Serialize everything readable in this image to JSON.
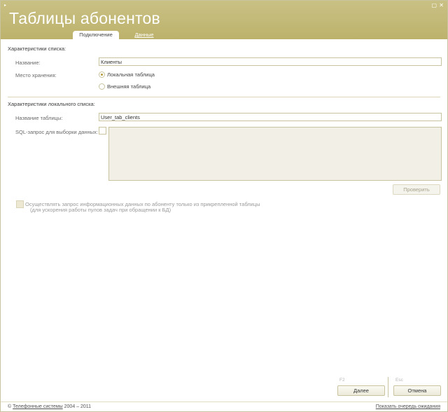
{
  "window": {
    "title": "Таблицы абонентов",
    "menu_glyph": "▸",
    "max_glyph": "▢",
    "close_glyph": "✕"
  },
  "tabs": [
    {
      "label": "Подключение",
      "active": true
    },
    {
      "label": "Данные",
      "active": false
    }
  ],
  "list_section": {
    "title": "Характеристики списка:",
    "name_label": "Название:",
    "name_value": "Клиенты",
    "storage_label": "Место хранения:",
    "storage_options": [
      {
        "label": "Локальная таблица",
        "selected": true
      },
      {
        "label": "Внешняя таблица",
        "selected": false
      }
    ]
  },
  "local_section": {
    "title": "Характеристики локального списка:",
    "table_label": "Название таблицы:",
    "table_value": "User_tab_clients",
    "sql_label": "SQL-запрос для выборки данных:",
    "sql_value": "",
    "check_button": "Проверить"
  },
  "option": {
    "line1": "Осуществлять запрос информационных данных по абоненту только из прикрепленной таблицы",
    "line2": "(для ускорения работы пулов задач при обращении к БД)",
    "checked": false
  },
  "actions": {
    "next_key": "F2",
    "next_label": "Далее",
    "cancel_key": "Esc",
    "cancel_label": "Отмена"
  },
  "footer": {
    "copyright_symbol": "©",
    "company": "Телефонные системы",
    "years": "2004 – 2011",
    "queue_link": "Показать очередь ожидания"
  },
  "colors": {
    "header": "#bfb46f",
    "border": "#c9c3a0",
    "text": "#4a4a4a"
  }
}
